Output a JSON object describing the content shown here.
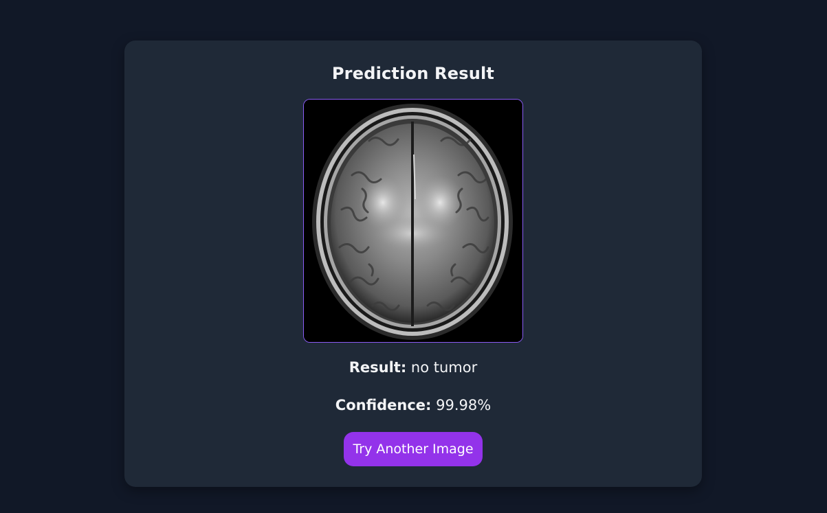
{
  "card": {
    "title": "Prediction Result",
    "image": {
      "subject": "brain MRI scan (axial)",
      "icon": "mri-image"
    },
    "result": {
      "label": "Result:",
      "value": "no tumor"
    },
    "confidence": {
      "label": "Confidence:",
      "value": "99.98%"
    },
    "button_label": "Try Another Image"
  },
  "colors": {
    "page_bg": "#111827",
    "card_bg": "#1f2937",
    "accent": "#9333ea",
    "image_border": "#8b5cf6",
    "text": "#f3f4f6"
  }
}
